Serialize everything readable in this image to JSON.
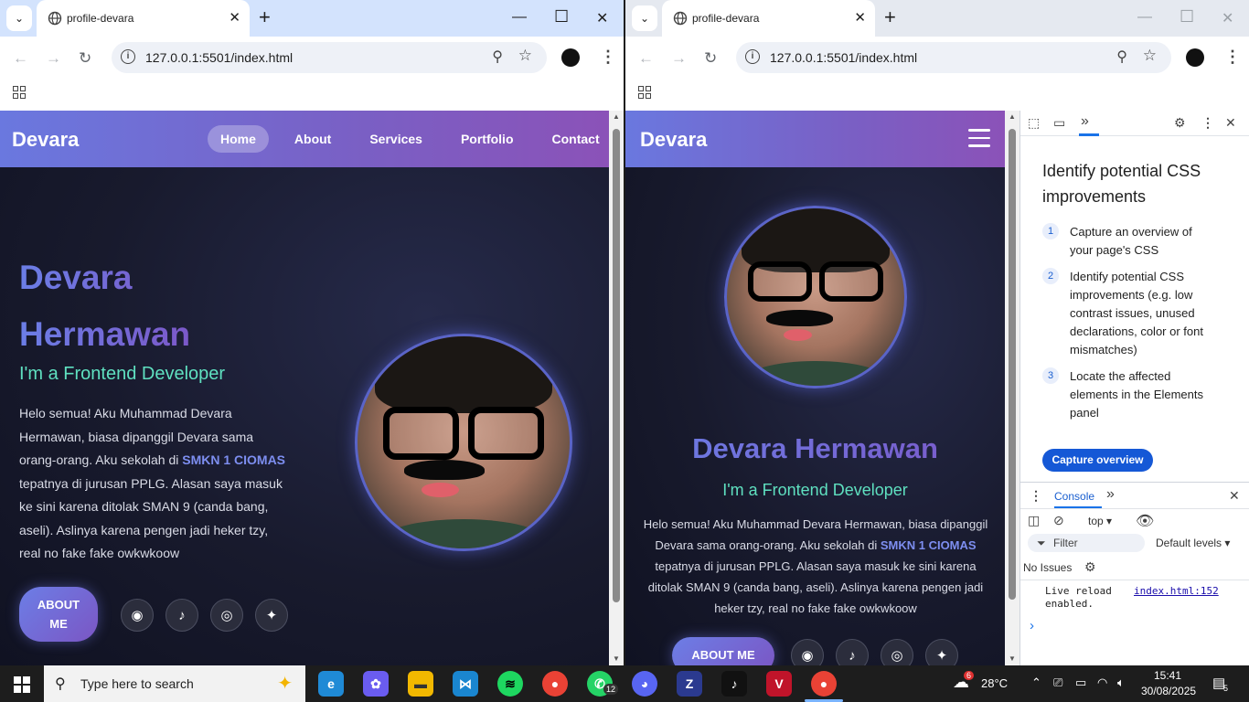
{
  "browser": {
    "tab_title": "profile-devara",
    "url": "127.0.0.1:5501/index.html"
  },
  "site": {
    "brand": "Devara",
    "nav": [
      "Home",
      "About",
      "Services",
      "Portfolio",
      "Contact"
    ],
    "active_nav": "Home",
    "name_line1": "Devara",
    "name_line2": "Hermawan",
    "name_full": "Devara Hermawan",
    "role": "I'm a Frontend Developer",
    "bio_before": "Helo semua! Aku Muhammad Devara Hermawan, biasa dipanggil Devara sama orang-orang. Aku sekolah di ",
    "bio_school": "SMKN 1 CIOMAS",
    "bio_after": " tepatnya di jurusan PPLG. Alasan saya masuk ke sini karena ditolak SMAN 9 (canda bang, aseli). Aslinya karena pengen jadi heker tzy, real no fake fake owkwkoow",
    "about_btn_left": "ABOUT ME",
    "about_btn_right": "ABOUT ME",
    "socials": [
      {
        "name": "github-icon",
        "glyph": "◉"
      },
      {
        "name": "tiktok-icon",
        "glyph": "♪"
      },
      {
        "name": "instagram-icon",
        "glyph": "◎"
      },
      {
        "name": "twitter-icon",
        "glyph": "✦"
      }
    ]
  },
  "devtools": {
    "heading": "Identify potential CSS improvements",
    "steps": [
      {
        "num": "1",
        "text": "Capture an overview of your page's CSS"
      },
      {
        "num": "2",
        "text": "Identify potential CSS improvements (e.g. low contrast issues, unused declarations, color or font mismatches)"
      },
      {
        "num": "3",
        "text": "Locate the affected elements in the Elements panel"
      }
    ],
    "capture_btn": "Capture overview",
    "console_tab": "Console",
    "context": "top",
    "filter_placeholder": "Filter",
    "levels": "Default levels",
    "issues": "No Issues",
    "log_message": "Live reload enabled.",
    "log_source": "index.html:152",
    "prompt": "›"
  },
  "taskbar": {
    "search_placeholder": "Type here to search",
    "temperature": "28°C",
    "weather_badge": "6",
    "whatsapp_badge": "12",
    "time": "15:41",
    "date": "30/08/2025",
    "notification_count": "5"
  },
  "colors": {
    "accent_purple": "#7b58c8",
    "accent_blue": "#6b7ee6",
    "role_green": "#5fe0c0",
    "chrome_blue": "#1a73e8"
  }
}
